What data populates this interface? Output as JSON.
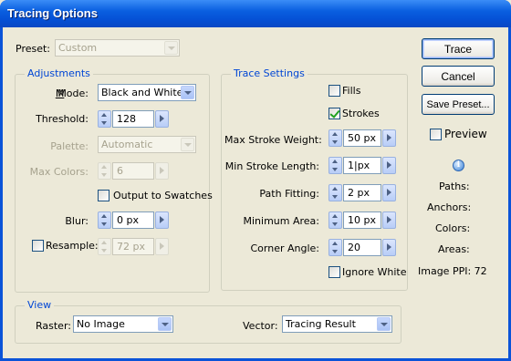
{
  "window": {
    "title": "Tracing Options"
  },
  "preset": {
    "label": "Preset:",
    "value": "Custom"
  },
  "adjustments": {
    "legend": "Adjustments",
    "mode": {
      "label": "Mode:",
      "value": "Black and White"
    },
    "threshold": {
      "label": "Threshold:",
      "value": "128"
    },
    "palette": {
      "label": "Palette:",
      "value": "Automatic"
    },
    "max_colors": {
      "label": "Max Colors:",
      "value": "6"
    },
    "output_to_swatches": {
      "label": "Output to Swatches",
      "checked": false
    },
    "blur": {
      "label": "Blur:",
      "value": "0 px"
    },
    "resample": {
      "label": "Resample:",
      "value": "72 px",
      "checked": false
    }
  },
  "trace_settings": {
    "legend": "Trace Settings",
    "fills": {
      "label": "Fills",
      "checked": false
    },
    "strokes": {
      "label": "Strokes",
      "checked": true
    },
    "max_stroke_weight": {
      "label": "Max Stroke Weight:",
      "value": "50 px"
    },
    "min_stroke_length": {
      "label": "Min Stroke Length:",
      "value": "1|px"
    },
    "path_fitting": {
      "label": "Path Fitting:",
      "value": "2 px"
    },
    "minimum_area": {
      "label": "Minimum Area:",
      "value": "10 px"
    },
    "corner_angle": {
      "label": "Corner Angle:",
      "value": "20"
    },
    "ignore_white": {
      "label": "Ignore White",
      "checked": false
    }
  },
  "buttons": {
    "trace": "Trace",
    "cancel": "Cancel",
    "save_preset": "Save Preset...",
    "preview": {
      "label": "Preview",
      "checked": false
    }
  },
  "info": {
    "paths": "Paths:",
    "anchors": "Anchors:",
    "colors": "Colors:",
    "areas": "Areas:",
    "image_ppi": "Image PPI: 72"
  },
  "view": {
    "legend": "View",
    "raster": {
      "label": "Raster:",
      "value": "No Image"
    },
    "vector": {
      "label": "Vector:",
      "value": "Tracing Result"
    }
  },
  "icons": [
    "dropdown-arrow-icon",
    "spinner-icon",
    "step-arrow-icon",
    "checkmark-icon",
    "info-icon"
  ],
  "colors": {
    "titlebar": "#0a5fe0",
    "legend": "#0046d5",
    "face": "#ece9d8"
  }
}
